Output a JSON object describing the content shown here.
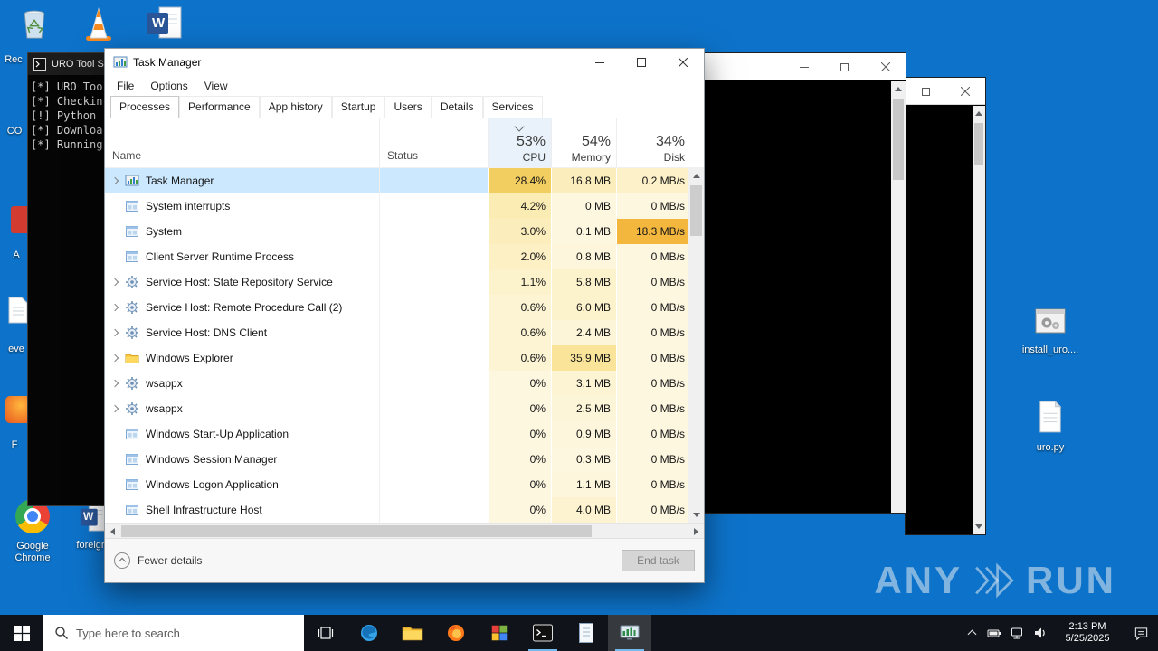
{
  "desktop": {
    "watermark_left": "ANY",
    "watermark_right": "RUN",
    "top_icons": [
      {
        "label": "Rec"
      },
      {
        "label": ""
      },
      {
        "label": "",
        "letter": "W"
      }
    ],
    "left_icons": [
      {
        "label": "CO"
      },
      {
        "label": "A"
      },
      {
        "label": "eve"
      },
      {
        "label": "F"
      },
      {
        "label": "Google Chrome"
      },
      {
        "label": "foreigr",
        "letter": "W"
      }
    ],
    "right_icons": [
      {
        "label": "install_uro...."
      },
      {
        "label": "uro.py"
      }
    ]
  },
  "console": {
    "title": "URO Tool S",
    "lines": [
      "[*] URO Too",
      "[*] Checkin",
      "[!] Python",
      "[*] Downloa",
      "[*] Running"
    ]
  },
  "task_manager": {
    "title": "Task Manager",
    "menus": [
      "File",
      "Options",
      "View"
    ],
    "tabs": [
      "Processes",
      "Performance",
      "App history",
      "Startup",
      "Users",
      "Details",
      "Services"
    ],
    "active_tab_index": 0,
    "header": {
      "name": "Name",
      "status": "Status",
      "cpu_pct": "53%",
      "cpu_label": "CPU",
      "mem_pct": "54%",
      "mem_label": "Memory",
      "disk_pct": "34%",
      "disk_label": "Disk"
    },
    "rows": [
      {
        "name": "Task Manager",
        "icon": "taskmgr",
        "expandable": true,
        "selected": true,
        "status": "",
        "cpu": "28.4%",
        "memory": "16.8 MB",
        "disk": "0.2 MB/s",
        "heat": {
          "cpu": "#f2cd60",
          "memory": "#fbeebc",
          "disk": "#fcf1c8"
        }
      },
      {
        "name": "System interrupts",
        "icon": "window",
        "expandable": false,
        "selected": false,
        "status": "",
        "cpu": "4.2%",
        "memory": "0 MB",
        "disk": "0 MB/s",
        "heat": {
          "cpu": "#fbecb4",
          "memory": "#fdf7e0",
          "disk": "#fdf7e0"
        }
      },
      {
        "name": "System",
        "icon": "window",
        "expandable": false,
        "selected": false,
        "status": "",
        "cpu": "3.0%",
        "memory": "0.1 MB",
        "disk": "18.3 MB/s",
        "heat": {
          "cpu": "#fbeebc",
          "memory": "#fdf7e0",
          "disk": "#f3b73e"
        }
      },
      {
        "name": "Client Server Runtime Process",
        "icon": "window",
        "expandable": false,
        "selected": false,
        "status": "",
        "cpu": "2.0%",
        "memory": "0.8 MB",
        "disk": "0 MB/s",
        "heat": {
          "cpu": "#fcf0c4",
          "memory": "#fdf6dc",
          "disk": "#fdf7e0"
        }
      },
      {
        "name": "Service Host: State Repository Service",
        "icon": "gear",
        "expandable": true,
        "selected": false,
        "status": "",
        "cpu": "1.1%",
        "memory": "5.8 MB",
        "disk": "0 MB/s",
        "heat": {
          "cpu": "#fcf2cc",
          "memory": "#fcf2cc",
          "disk": "#fdf7e0"
        }
      },
      {
        "name": "Service Host: Remote Procedure Call (2)",
        "icon": "gear",
        "expandable": true,
        "selected": false,
        "status": "",
        "cpu": "0.6%",
        "memory": "6.0 MB",
        "disk": "0 MB/s",
        "heat": {
          "cpu": "#fdf4d4",
          "memory": "#fcf2cc",
          "disk": "#fdf7e0"
        }
      },
      {
        "name": "Service Host: DNS Client",
        "icon": "gear",
        "expandable": true,
        "selected": false,
        "status": "",
        "cpu": "0.6%",
        "memory": "2.4 MB",
        "disk": "0 MB/s",
        "heat": {
          "cpu": "#fdf4d4",
          "memory": "#fdf5d8",
          "disk": "#fdf7e0"
        }
      },
      {
        "name": "Windows Explorer",
        "icon": "folder",
        "expandable": true,
        "selected": false,
        "status": "",
        "cpu": "0.6%",
        "memory": "35.9 MB",
        "disk": "0 MB/s",
        "heat": {
          "cpu": "#fdf4d4",
          "memory": "#fae49a",
          "disk": "#fdf7e0"
        }
      },
      {
        "name": "wsappx",
        "icon": "gear",
        "expandable": true,
        "selected": false,
        "status": "",
        "cpu": "0%",
        "memory": "3.1 MB",
        "disk": "0 MB/s",
        "heat": {
          "cpu": "#fdf7e0",
          "memory": "#fdf4d4",
          "disk": "#fdf7e0"
        }
      },
      {
        "name": "wsappx",
        "icon": "gear",
        "expandable": true,
        "selected": false,
        "status": "",
        "cpu": "0%",
        "memory": "2.5 MB",
        "disk": "0 MB/s",
        "heat": {
          "cpu": "#fdf7e0",
          "memory": "#fdf5d8",
          "disk": "#fdf7e0"
        }
      },
      {
        "name": "Windows Start-Up Application",
        "icon": "window",
        "expandable": false,
        "selected": false,
        "status": "",
        "cpu": "0%",
        "memory": "0.9 MB",
        "disk": "0 MB/s",
        "heat": {
          "cpu": "#fdf7e0",
          "memory": "#fdf6dc",
          "disk": "#fdf7e0"
        }
      },
      {
        "name": "Windows Session Manager",
        "icon": "window",
        "expandable": false,
        "selected": false,
        "status": "",
        "cpu": "0%",
        "memory": "0.3 MB",
        "disk": "0 MB/s",
        "heat": {
          "cpu": "#fdf7e0",
          "memory": "#fdf7e0",
          "disk": "#fdf7e0"
        }
      },
      {
        "name": "Windows Logon Application",
        "icon": "window",
        "expandable": false,
        "selected": false,
        "status": "",
        "cpu": "0%",
        "memory": "1.1 MB",
        "disk": "0 MB/s",
        "heat": {
          "cpu": "#fdf7e0",
          "memory": "#fdf6dc",
          "disk": "#fdf7e0"
        }
      },
      {
        "name": "Shell Infrastructure Host",
        "icon": "window",
        "expandable": false,
        "selected": false,
        "status": "",
        "cpu": "0%",
        "memory": "4.0 MB",
        "disk": "0 MB/s",
        "heat": {
          "cpu": "#fdf7e0",
          "memory": "#fdf3d0",
          "disk": "#fdf7e0"
        }
      }
    ],
    "footer": {
      "toggle": "Fewer details",
      "end_task": "End task"
    }
  },
  "taskbar": {
    "search_placeholder": "Type here to search",
    "clock_time": "2:13 PM",
    "clock_date": "5/25/2025"
  }
}
